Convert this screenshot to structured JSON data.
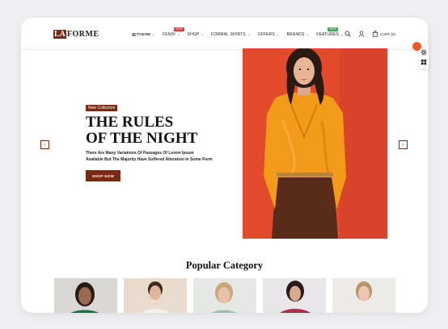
{
  "header": {
    "logo_mark": "LA",
    "logo_text": "FORME",
    "nav": [
      {
        "label": "ഇന്നത്തെ",
        "chevron": true,
        "badge": ""
      },
      {
        "label": "FENDI",
        "chevron": true,
        "badge": "NEW",
        "badge_color": "#d83a3a"
      },
      {
        "label": "SHOP",
        "chevron": true,
        "badge": ""
      },
      {
        "label": "FORMAL SHIRTS",
        "chevron": true,
        "badge": ""
      },
      {
        "label": "OFFERS",
        "chevron": true,
        "badge": ""
      },
      {
        "label": "BRANDS",
        "chevron": true,
        "badge": ""
      },
      {
        "label": "FEATURES",
        "chevron": true,
        "badge": "NEW",
        "badge_color": "#3aa655"
      }
    ],
    "cart_label": "CART (0)",
    "icons": [
      "search-icon",
      "user-icon",
      "cart-icon"
    ]
  },
  "floating": {
    "icons": [
      "gear-icon",
      "grid-icon"
    ]
  },
  "hero": {
    "tag": "New Collection",
    "title_line1": "THE RULES",
    "title_line2": "OF THE NIGHT",
    "desc_line1": "There Are Many Variations Of Passages Of Lorem Ipsum",
    "desc_line2": "Available But The Majority Have Suffered Alteration In Some Form",
    "button": "SHOP NOW",
    "prev_arrow": "‹",
    "next_arrow": "›"
  },
  "categories": {
    "title": "Popular Category"
  },
  "colors": {
    "brand": "#7a2a12",
    "hero_bg": "#e64a2a",
    "accent": "#f05a28"
  }
}
